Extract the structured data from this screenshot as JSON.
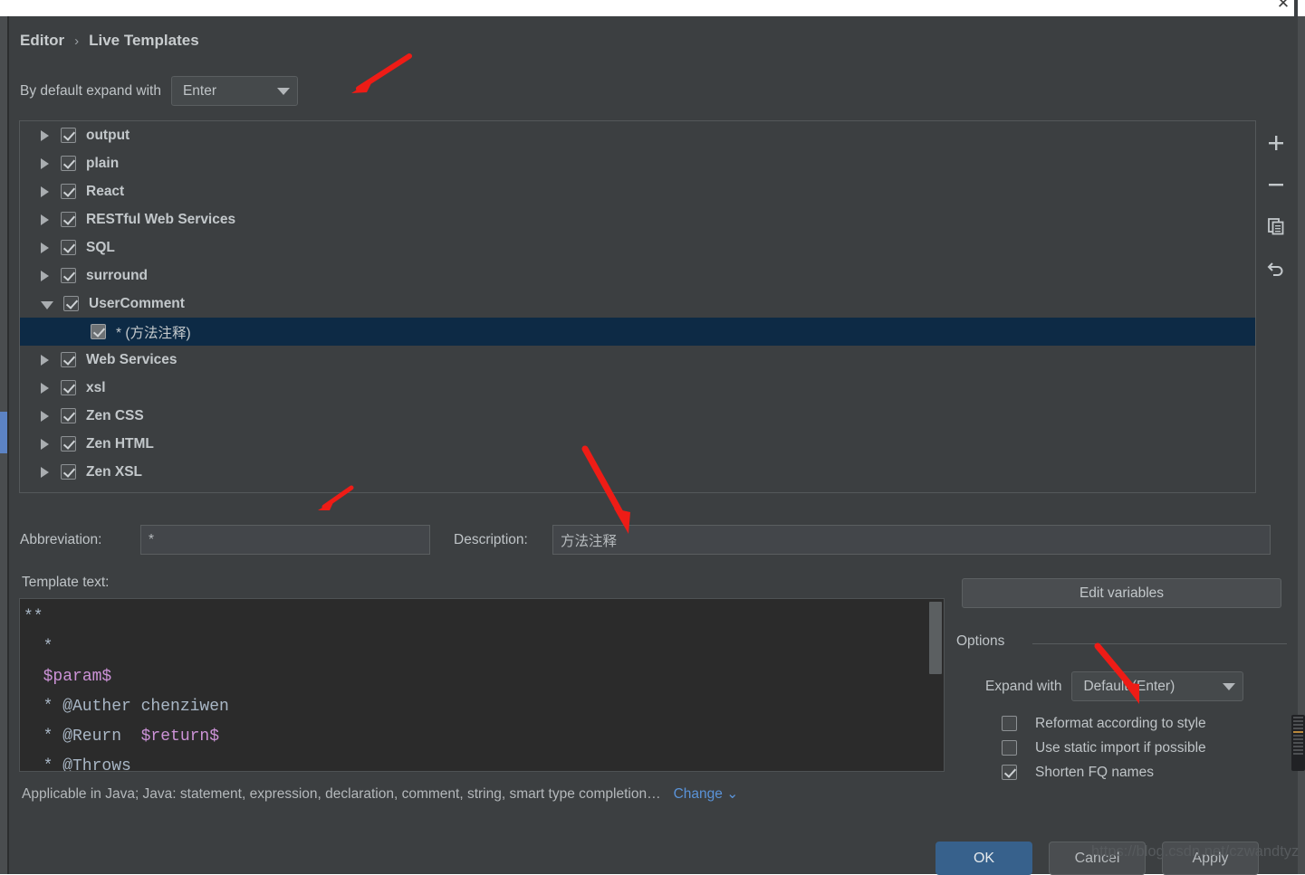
{
  "window": {
    "close_icon": "close-icon"
  },
  "breadcrumb": {
    "root": "Editor",
    "separator": "›",
    "current": "Live Templates"
  },
  "default_expand": {
    "label": "By default expand with",
    "value": "Enter"
  },
  "tree": {
    "items": [
      {
        "label": "output",
        "expanded": false,
        "checked": true,
        "child": false,
        "selected": false
      },
      {
        "label": "plain",
        "expanded": false,
        "checked": true,
        "child": false,
        "selected": false
      },
      {
        "label": "React",
        "expanded": false,
        "checked": true,
        "child": false,
        "selected": false
      },
      {
        "label": "RESTful Web Services",
        "expanded": false,
        "checked": true,
        "child": false,
        "selected": false
      },
      {
        "label": "SQL",
        "expanded": false,
        "checked": true,
        "child": false,
        "selected": false
      },
      {
        "label": "surround",
        "expanded": false,
        "checked": true,
        "child": false,
        "selected": false
      },
      {
        "label": "UserComment",
        "expanded": true,
        "checked": true,
        "child": false,
        "selected": false
      },
      {
        "label": "* (方法注释)",
        "expanded": null,
        "checked": true,
        "child": true,
        "selected": true
      },
      {
        "label": "Web Services",
        "expanded": false,
        "checked": true,
        "child": false,
        "selected": false
      },
      {
        "label": "xsl",
        "expanded": false,
        "checked": true,
        "child": false,
        "selected": false
      },
      {
        "label": "Zen CSS",
        "expanded": false,
        "checked": true,
        "child": false,
        "selected": false
      },
      {
        "label": "Zen HTML",
        "expanded": false,
        "checked": true,
        "child": false,
        "selected": false
      },
      {
        "label": "Zen XSL",
        "expanded": false,
        "checked": true,
        "child": false,
        "selected": false
      }
    ]
  },
  "toolbar": {
    "add": "+",
    "remove": "−",
    "duplicate": "duplicate-icon",
    "revert": "revert-icon"
  },
  "fields": {
    "abbreviation_label": "Abbreviation:",
    "abbreviation_value": "*",
    "description_label": "Description:",
    "description_value": "方法注释",
    "template_text_label": "Template text:"
  },
  "template_text": {
    "lines": [
      {
        "text": "**",
        "var": false
      },
      {
        "text": "  *",
        "var": false
      },
      {
        "text": "  $param$",
        "var": true
      },
      {
        "text": "  * @Auther chenziwen",
        "var": false
      },
      {
        "text": "  * @Reurn  $return$",
        "var": false
      },
      {
        "text": "  * @Throws",
        "var": false
      }
    ]
  },
  "applicable": {
    "text": "Applicable in Java; Java: statement, expression, declaration, comment, string, smart type completion…",
    "change_label": "Change",
    "change_caret": "⌄"
  },
  "options": {
    "edit_variables_label": "Edit variables",
    "group_label": "Options",
    "expand_with_label": "Expand with",
    "expand_with_value": "Default (Enter)",
    "checkboxes": [
      {
        "label": "Reformat according to style",
        "checked": false
      },
      {
        "label": "Use static import if possible",
        "checked": false
      },
      {
        "label": "Shorten FQ names",
        "checked": true
      }
    ]
  },
  "buttons": {
    "ok": "OK",
    "cancel": "Cancel",
    "apply": "Apply"
  },
  "watermark": {
    "text": "https://blog.csdn.net/czwandtyz"
  },
  "colors": {
    "dialog_bg": "#3c3f41",
    "selection": "#0d2a45",
    "accent": "#5c83c4",
    "link": "#5a93d8",
    "primary_button": "#37618c",
    "annotation_arrow": "#ee1c16",
    "editor_bg": "#2b2b2b",
    "template_var": "#cb92d6"
  }
}
